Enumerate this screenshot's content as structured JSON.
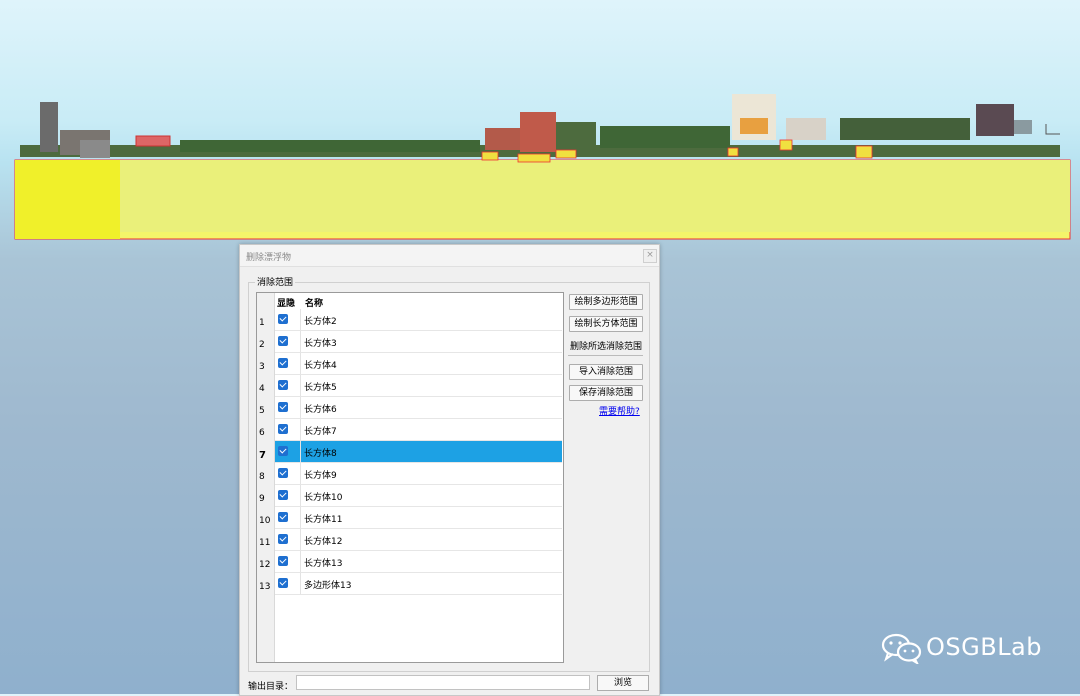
{
  "dialog": {
    "title": "删除漂浮物",
    "close_label": "×",
    "group_label": "消除范围",
    "table": {
      "col_visible": "显隐",
      "col_name": "名称",
      "rows": [
        {
          "num": "1",
          "name": "长方体2",
          "checked": true
        },
        {
          "num": "2",
          "name": "长方体3",
          "checked": true
        },
        {
          "num": "3",
          "name": "长方体4",
          "checked": true
        },
        {
          "num": "4",
          "name": "长方体5",
          "checked": true
        },
        {
          "num": "5",
          "name": "长方体6",
          "checked": true
        },
        {
          "num": "6",
          "name": "长方体7",
          "checked": true
        },
        {
          "num": "7",
          "name": "长方体8",
          "checked": true,
          "selected": true
        },
        {
          "num": "8",
          "name": "长方体9",
          "checked": true
        },
        {
          "num": "9",
          "name": "长方体10",
          "checked": true
        },
        {
          "num": "10",
          "name": "长方体11",
          "checked": true
        },
        {
          "num": "11",
          "name": "长方体12",
          "checked": true
        },
        {
          "num": "12",
          "name": "长方体13",
          "checked": true
        },
        {
          "num": "13",
          "name": "多边形体13",
          "checked": true
        }
      ]
    },
    "buttons": {
      "draw_polygon": "绘制多边形范围",
      "draw_box": "绘制长方体范围",
      "delete_selected": "删除所选消除范围",
      "import_range": "导入消除范围",
      "save_range": "保存消除范围",
      "help_link": "需要帮助?"
    },
    "output_label": "输出目录：",
    "output_value": "",
    "browse_label": "浏览"
  },
  "watermark": {
    "text": "OSGBLab",
    "icon": "wechat-icon"
  },
  "colors": {
    "selection": "#1da1e4",
    "checkbox": "#1e6fd0",
    "volume_fill": "#f4f56a",
    "link": "#0000ee"
  }
}
